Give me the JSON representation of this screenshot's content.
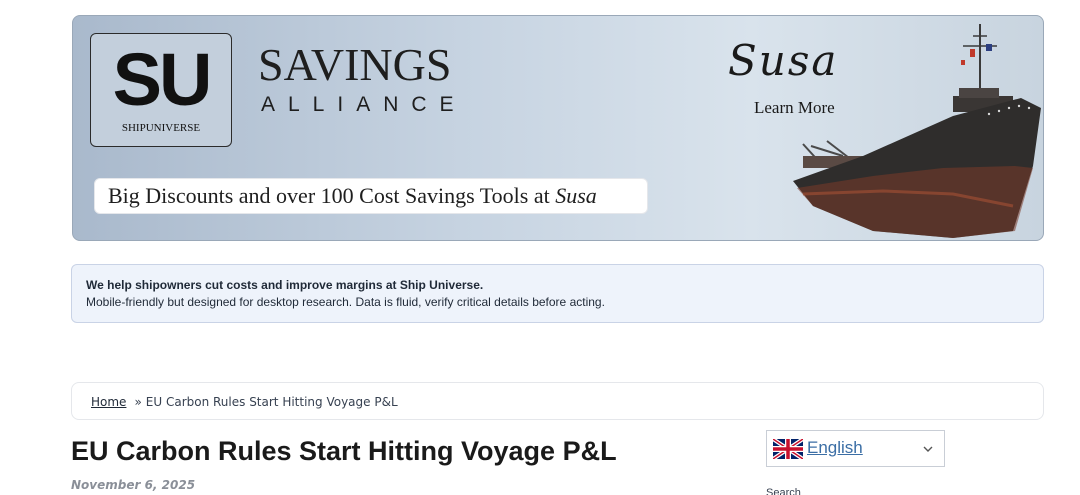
{
  "banner": {
    "su_letters": "SU",
    "su_sub": "SHIPUNIVERSE",
    "savings": "SAVINGS",
    "alliance": "ALLIANCE",
    "tagline_main": "Big Discounts and over 100 Cost Savings Tools at ",
    "tagline_brand": "Susa",
    "susa_logo": "Susa",
    "learn_more": "Learn More"
  },
  "notice": {
    "strong": "We help shipowners cut costs and improve margins at Ship Universe.",
    "line": "Mobile-friendly but designed for desktop research. Data is fluid, verify critical details before acting."
  },
  "breadcrumb": {
    "home": "Home",
    "separator": "»",
    "current": "EU Carbon Rules Start Hitting Voyage P&L"
  },
  "article": {
    "title": "EU Carbon Rules Start Hitting Voyage P&L",
    "date": "November 6, 2025"
  },
  "sidebar": {
    "language": "English",
    "search_label": "Search"
  },
  "colors": {
    "link": "#3b6ea5",
    "notice_bg": "#eef3fb",
    "date": "#8a8f98"
  }
}
